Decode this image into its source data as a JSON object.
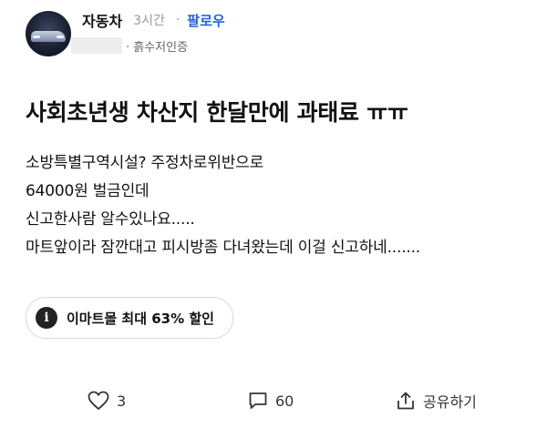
{
  "post": {
    "author": "자동차",
    "time": "3시간",
    "separator": "·",
    "follow_label": "팔로우",
    "certification": "· 흙수저인증",
    "title": "사회초년생 차산지 한달만에 과태료 ㅠㅠ",
    "body_lines": [
      "소방특별구역시설? 주정차로위반으로",
      "64000원 벌금인데",
      "신고한사람 알수있나요.....",
      "마트앞이라 잠깐대고 피시방좀 다녀왔는데 이걸 신고하네......."
    ]
  },
  "promo": {
    "icon": "info-icon",
    "icon_glyph": "i",
    "label": "이마트몰 최대 63% 할인"
  },
  "actions": {
    "like_count": "3",
    "comment_count": "60",
    "share_label": "공유하기"
  },
  "colors": {
    "follow": "#2563d9",
    "muted": "#9a9a9a",
    "text": "#111111"
  }
}
